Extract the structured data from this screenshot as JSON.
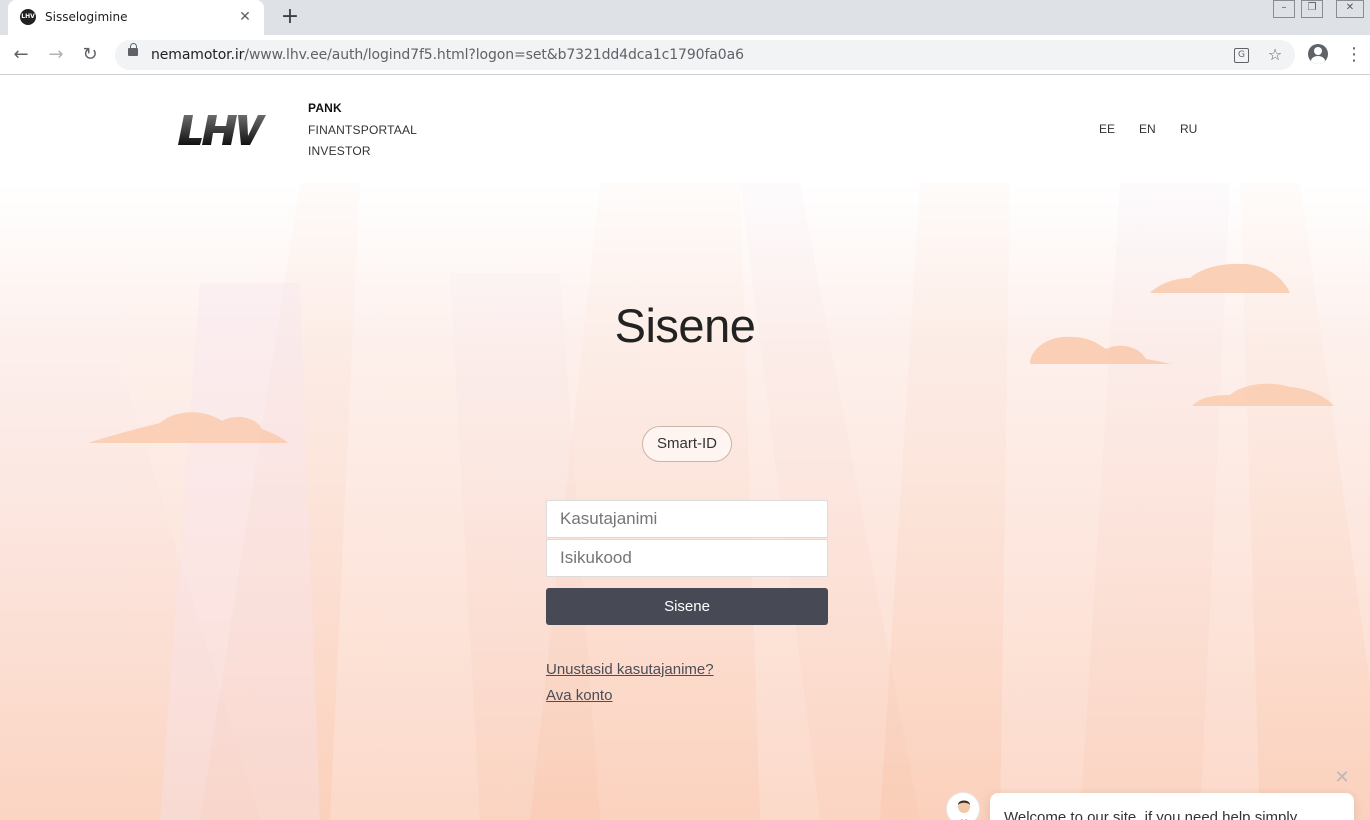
{
  "browser": {
    "tab_title": "Sisselogimine",
    "tab_favicon_text": "LHV",
    "url_host": "nemamotor.ir",
    "url_rest": "/www.lhv.ee/auth/logind7f5.html?logon=set&b7321dd4dca1c1790fa0a6"
  },
  "site": {
    "logo_text": "LHV",
    "nav": [
      "PANK",
      "FINANTSPORTAAL",
      "INVESTOR"
    ],
    "languages": [
      "EE",
      "EN",
      "RU"
    ]
  },
  "login": {
    "heading": "Sisene",
    "smartid_label": "Smart-ID",
    "username_placeholder": "Kasutajanimi",
    "idcode_placeholder": "Isikukood",
    "submit_label": "Sisene",
    "forgot_link": "Unustasid kasutajanime?",
    "open_account_link": "Ava konto"
  },
  "chat": {
    "message": "Welcome to our site, if you need help simply"
  },
  "colors": {
    "button_bg": "#474a54",
    "background_peach": "#f8c9b0",
    "cloud": "#f9c7a7"
  }
}
